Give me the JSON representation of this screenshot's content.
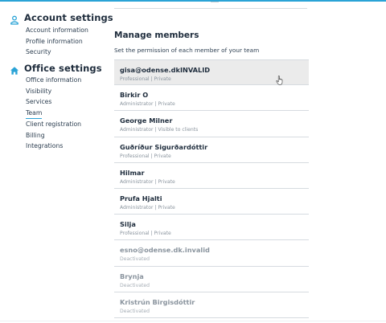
{
  "sidebar": {
    "account": {
      "title": "Account settings",
      "icon": "user-icon",
      "items": [
        {
          "label": "Account information"
        },
        {
          "label": "Profile information"
        },
        {
          "label": "Security"
        }
      ]
    },
    "office": {
      "title": "Office settings",
      "icon": "home-icon",
      "items": [
        {
          "label": "Office information"
        },
        {
          "label": "Visibility"
        },
        {
          "label": "Services"
        },
        {
          "label": "Team",
          "active": true
        },
        {
          "label": "Client registration"
        },
        {
          "label": "Billing"
        },
        {
          "label": "Integrations"
        }
      ]
    }
  },
  "main": {
    "title": "Manage members",
    "subtitle": "Set the permission of each member of your team",
    "members": [
      {
        "name": "gisa@odense.dkINVALID",
        "meta": "Professional | Private"
      },
      {
        "name": "Birkir O",
        "meta": "Administrator | Private"
      },
      {
        "name": "George Milner",
        "meta": "Administrator | Visible to clients"
      },
      {
        "name": "Guðríður Sigurðardóttir",
        "meta": "Professional | Private"
      },
      {
        "name": "Hilmar",
        "meta": "Administrator | Private"
      },
      {
        "name": "Prufa Hjalti",
        "meta": "Administrator | Private"
      },
      {
        "name": "Silja",
        "meta": "Professional | Private"
      },
      {
        "name": "esno@odense.dk.invalid",
        "meta": "Deactivated"
      },
      {
        "name": "Brynja",
        "meta": "Deactivated"
      },
      {
        "name": "Kristrún Birgisdóttir",
        "meta": "Deactivated"
      }
    ]
  },
  "colors": {
    "accent": "#2aa3d6",
    "hover_row": "#ebebeb",
    "text": "#1f2d3d",
    "muted": "#8a949e"
  }
}
